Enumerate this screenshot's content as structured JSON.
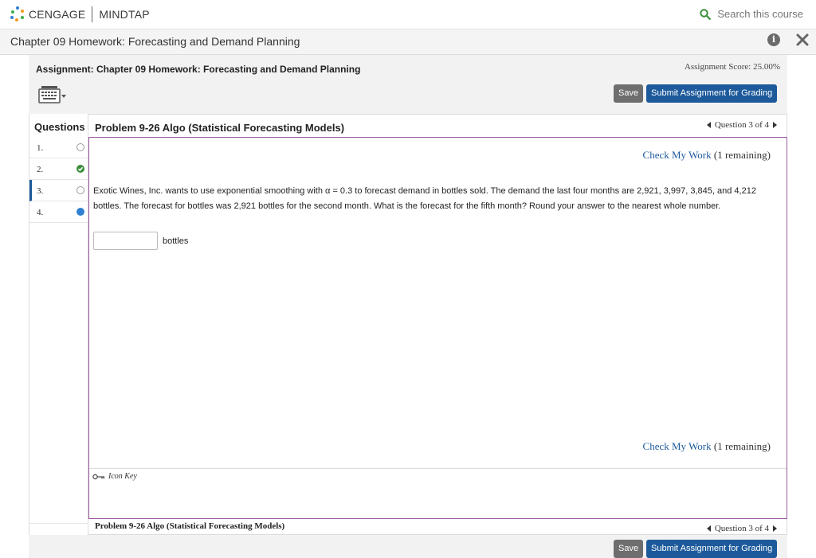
{
  "topbar": {
    "brand": "CENGAGE",
    "product": "MINDTAP",
    "search_label": "Search this course",
    "logo_colors": [
      "#2f80d1",
      "#f29c1f",
      "#3fae49",
      "#2f80d1",
      "#f29c1f",
      "#3fae49"
    ]
  },
  "chapter": {
    "title": "Chapter 09 Homework: Forecasting and Demand Planning",
    "info_icon": "i"
  },
  "assignment": {
    "title": "Assignment: Chapter 09 Homework: Forecasting and Demand Planning",
    "score": "Assignment Score: 25.00%",
    "save_label": "Save",
    "submit_label": "Submit Assignment for Grading"
  },
  "questions": {
    "heading": "Questions",
    "items": [
      {
        "number": "1.",
        "status": "empty"
      },
      {
        "number": "2.",
        "status": "done"
      },
      {
        "number": "3.",
        "status": "empty"
      },
      {
        "number": "4.",
        "status": "current"
      }
    ]
  },
  "problem": {
    "title": "Problem 9-26 Algo (Statistical Forecasting Models)",
    "nav_label": "Question 3 of 4",
    "check_link": "Check My Work",
    "check_remaining": "(1 remaining)",
    "text": "Exotic Wines, Inc. wants to use exponential smoothing with α = 0.3 to forecast demand in bottles sold. The demand the last four months are 2,921, 3,997, 3,845, and 4,212 bottles. The forecast for bottles was 2,921 bottles for the second month. What is the forecast for the fifth month? Round your answer to the nearest whole number.",
    "answer_value": "",
    "answer_unit": "bottles",
    "icon_key_label": "Icon Key"
  },
  "footer": {
    "title": "Problem 9-26 Algo (Statistical Forecasting Models)",
    "nav_label": "Question 3 of 4",
    "save_label": "Save",
    "submit_label": "Submit Assignment for Grading"
  },
  "colors": {
    "accent": "#1d5a9b",
    "problem_border": "#9b5a9e",
    "done": "#3a8f3a",
    "current": "#2f80d1"
  }
}
